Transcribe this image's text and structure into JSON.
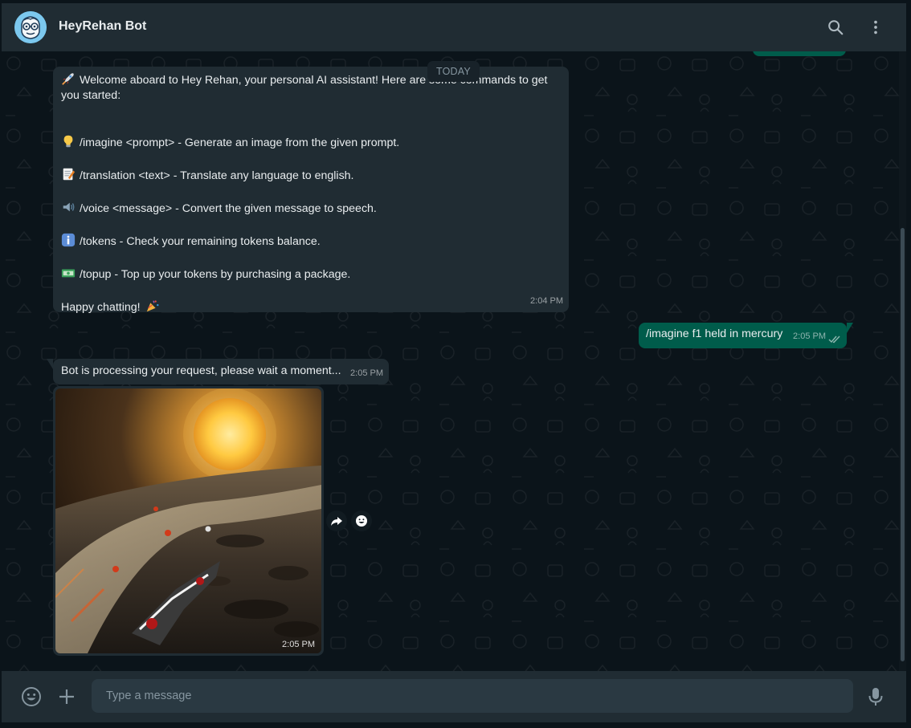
{
  "header": {
    "title": "HeyRehan Bot",
    "avatar_icon": "nerd-face-icon",
    "search_icon": "search-icon",
    "menu_icon": "more-vertical-icon"
  },
  "colors": {
    "background": "#0b141a",
    "header": "#202c33",
    "incoming_bubble": "#202c33",
    "outgoing_bubble": "#005c4b",
    "input": "#2a3942",
    "secondary_text": "#8696a0",
    "read_ticks": "#53bdeb"
  },
  "chat": {
    "date_divider": "TODAY",
    "welcome": {
      "intro_line1": "Welcome aboard to Hey Rehan, your personal AI assistant! Here are some commands to get",
      "intro_line2": "you started:",
      "cmd_imagine": "/imagine <prompt> - Generate an image from the given prompt.",
      "cmd_translation": "/translation <text> - Translate any language to english.",
      "cmd_voice": "/voice <message> - Convert the given message to speech.",
      "cmd_tokens": "/tokens - Check your remaining tokens balance.",
      "cmd_topup": "/topup - Top up your tokens by purchasing a package.",
      "outro": "Happy chatting!",
      "time": "2:04 PM",
      "icons": [
        "rocket-icon",
        "light-bulb-icon",
        "memo-icon",
        "speaker-icon",
        "info-icon",
        "banknote-icon",
        "party-popper-icon"
      ]
    },
    "outgoing": {
      "text": "/imagine f1 held in mercury",
      "time": "2:05 PM",
      "status": "read"
    },
    "processing": {
      "text": "Bot is processing your request, please wait a moment...",
      "time": "2:05 PM"
    },
    "image_message": {
      "alt": "F1 cars racing on Mercury surface",
      "time": "2:05 PM"
    }
  },
  "footer": {
    "placeholder": "Type a message",
    "emoji_icon": "emoji-icon",
    "attach_icon": "plus-icon",
    "mic_icon": "microphone-icon"
  }
}
